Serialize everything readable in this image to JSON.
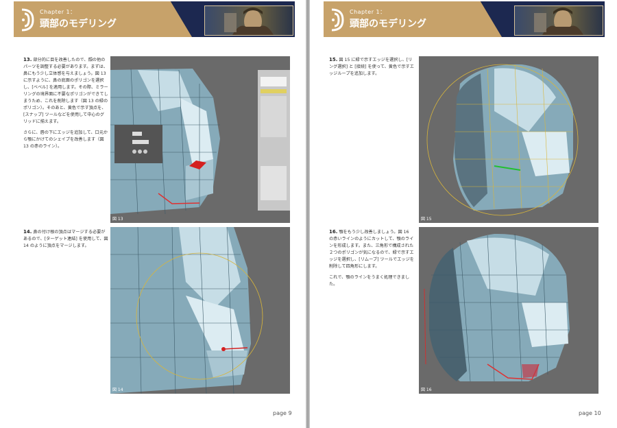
{
  "left": {
    "chapter": "Chapter 1：",
    "title": "頭部のモデリング",
    "step13": {
      "num": "13.",
      "p1": "部分的に目を改善したので、顔の他のパーツを調整する必要があります。まずは、鼻にもう少し立体感を与えましょう。図 13 に示すように、鼻の底面のポリゴンを選択し、[ベベル] を適用します。その際、ミラーリングの境界面に不要なポリゴンができてしまうため、これを削除します（図 13 の緑のポリゴン）。そのあと、黄色で示す頂点を、[スナップ] ツールなどを使用して中心のグリッドに揃えます。",
      "p2": "さらに、唇の下にエッジを追加して、口元から顎にかけてのシェイプを改善します（図 13 の赤のライン）。"
    },
    "fig13": "図 13",
    "step14": {
      "num": "14.",
      "p1": "鼻の付け根の頂点はマージする必要があるので、[ターゲット連結] を使用して、図 14 のように頂点をマージします。"
    },
    "fig14": "図 14",
    "page": "page 9"
  },
  "right": {
    "chapter": "Chapter 1：",
    "title": "頭部のモデリング",
    "step15": {
      "num": "15.",
      "p1": "図 15 に緑で示すエッジを選択し、[リング選択] と [接続] を使って、黄色で示すエッジループを追加します。"
    },
    "fig15": "図 15",
    "step16": {
      "num": "16.",
      "p1": "顎をもう少し改善しましょう。図 16 の赤いラインのようにカットして、顎のラインを形成します。また、三角形で構成された２つのポリゴンが気になるので、緑で示すエッジを選択し、[リムーブ] ツールでエッジを削除して四角形にします。",
      "p2": "これで、顎のラインをうまく処理できました。"
    },
    "fig16": "図 16",
    "page": "page 10"
  },
  "colors": {
    "navy": "#1c2850",
    "gold": "#c7a26a",
    "mesh": "#8fb4c4"
  }
}
